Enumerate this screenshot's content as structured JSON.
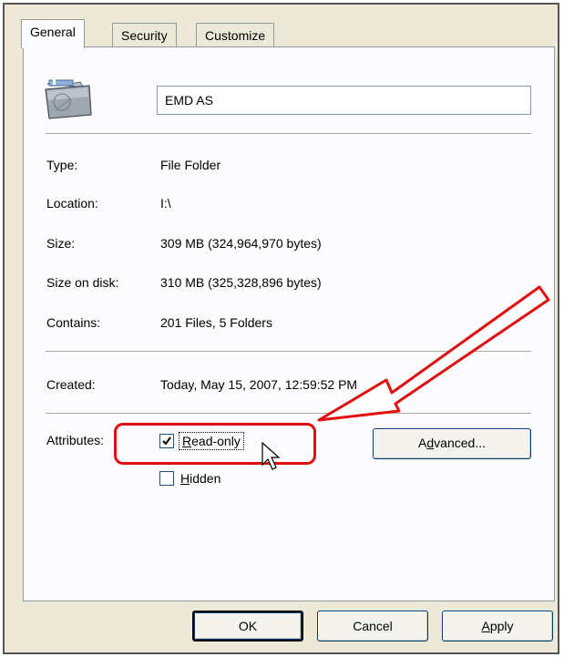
{
  "tabs": [
    {
      "label": "General",
      "active": true
    },
    {
      "label": "Security",
      "active": false
    },
    {
      "label": "Customize",
      "active": false
    }
  ],
  "folder": {
    "icon": "folder-icon",
    "name": "EMD AS"
  },
  "properties": [
    {
      "label": "Type:",
      "value": "File Folder"
    },
    {
      "label": "Location:",
      "value": "I:\\"
    },
    {
      "label": "Size:",
      "value": "309 MB (324,964,970 bytes)"
    },
    {
      "label": "Size on disk:",
      "value": "310 MB (325,328,896 bytes)"
    },
    {
      "label": "Contains:",
      "value": "201 Files, 5 Folders"
    }
  ],
  "created": {
    "label": "Created:",
    "value": "Today, May 15, 2007, 12:59:52 PM"
  },
  "attributes": {
    "label": "Attributes:",
    "read_only": {
      "pre": "",
      "key": "R",
      "post": "ead-only",
      "checked": true
    },
    "hidden": {
      "pre": "",
      "key": "H",
      "post": "idden",
      "checked": false
    },
    "advanced": {
      "pre": "A",
      "key": "d",
      "post": "vanced..."
    }
  },
  "buttons": {
    "ok": "OK",
    "cancel": "Cancel",
    "apply": {
      "key": "A",
      "post": "pply"
    }
  },
  "annotation": {
    "highlight_color": "#e01010"
  }
}
